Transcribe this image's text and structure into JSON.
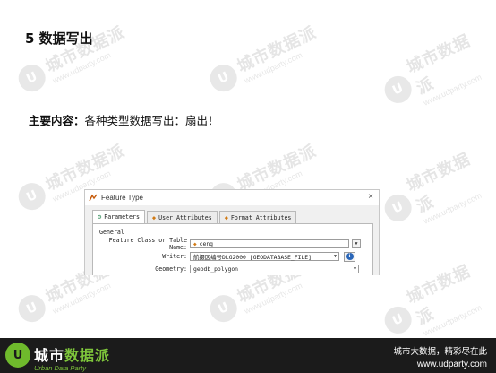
{
  "slide": {
    "title": "5 数据写出",
    "content_label": "主要内容：",
    "content_text": "各种类型数据写出：扇出！"
  },
  "watermark": {
    "name": "城市数据派",
    "url": "www.udparty.com"
  },
  "dialog": {
    "title": "Feature Type",
    "close_glyph": "×",
    "tabs": [
      {
        "label": "Parameters",
        "active": true,
        "icon": "gear-icon"
      },
      {
        "label": "User Attributes",
        "active": false,
        "icon": "diamond-icon"
      },
      {
        "label": "Format Attributes",
        "active": false,
        "icon": "diamond-icon"
      }
    ],
    "group_label": "General",
    "feature_class_label": "Feature Class or Table Name:",
    "feature_class_value": "ceng",
    "writer_label": "Writer:",
    "writer_value": "航摄区编号DLG2000 [GEODATABASE_FILE]",
    "geometry_label": "Geometry:",
    "geometry_value": "geodb_polygon",
    "info_glyph": "i",
    "dropdown_glyph": "▼"
  },
  "footer": {
    "logo_glyph": "U",
    "brand_part1": "城市",
    "brand_part2": "数据派",
    "brand_sub": "Urban Data Party",
    "slogan": "城市大数据，精彩尽在此",
    "url": "www.udparty.com"
  },
  "colors": {
    "brand_green": "#7ec53b",
    "footer_bg": "#1b1b1b",
    "info_blue": "#2a66b8"
  }
}
